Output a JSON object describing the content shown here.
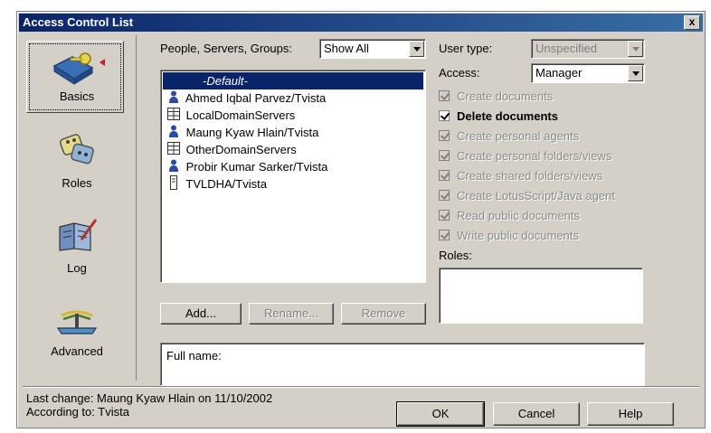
{
  "window": {
    "title": "Access Control List",
    "close_glyph": "x"
  },
  "nav": {
    "items": [
      {
        "label": "Basics",
        "icon": "key-folder-icon",
        "selected": true
      },
      {
        "label": "Roles",
        "icon": "roles-icon",
        "selected": false
      },
      {
        "label": "Log",
        "icon": "log-book-icon",
        "selected": false
      },
      {
        "label": "Advanced",
        "icon": "advanced-icon",
        "selected": false
      }
    ]
  },
  "filter": {
    "label": "People, Servers, Groups:",
    "value": "Show All"
  },
  "entries": [
    {
      "name": "-Default-",
      "icon": "",
      "selected": true
    },
    {
      "name": "Ahmed Iqbal Parvez/Tvista",
      "icon": "person-icon"
    },
    {
      "name": "LocalDomainServers",
      "icon": "server-group-icon"
    },
    {
      "name": "Maung Kyaw Hlain/Tvista",
      "icon": "person-icon"
    },
    {
      "name": "OtherDomainServers",
      "icon": "server-group-icon"
    },
    {
      "name": "Probir Kumar Sarker/Tvista",
      "icon": "person-icon"
    },
    {
      "name": "TVLDHA/Tvista",
      "icon": "server-icon"
    }
  ],
  "user_type": {
    "label": "User type:",
    "value": "Unspecified"
  },
  "access": {
    "label": "Access:",
    "value": "Manager"
  },
  "permissions": [
    {
      "label": "Create documents",
      "checked": true,
      "enabled": false
    },
    {
      "label": "Delete documents",
      "checked": true,
      "enabled": true
    },
    {
      "label": "Create personal agents",
      "checked": true,
      "enabled": false
    },
    {
      "label": "Create personal folders/views",
      "checked": true,
      "enabled": false
    },
    {
      "label": "Create shared folders/views",
      "checked": true,
      "enabled": false
    },
    {
      "label": "Create LotusScript/Java agent",
      "checked": true,
      "enabled": false
    },
    {
      "label": "Read public documents",
      "checked": true,
      "enabled": false
    },
    {
      "label": "Write public documents",
      "checked": true,
      "enabled": false
    }
  ],
  "roles": {
    "label": "Roles:"
  },
  "list_buttons": {
    "add": "Add...",
    "rename": "Rename...",
    "remove": "Remove"
  },
  "full_name": {
    "label": "Full name:"
  },
  "status": {
    "last_change": "Last change: Maung Kyaw Hlain on 11/10/2002",
    "according_to": "According to: Tvista"
  },
  "dialog_buttons": {
    "ok": "OK",
    "cancel": "Cancel",
    "help": "Help"
  },
  "colors": {
    "face": "#d4d0c8",
    "selection": "#0a246a",
    "title_start": "#0a246a",
    "title_end": "#3a6ea5",
    "person_icon": "#2b4aa8"
  }
}
